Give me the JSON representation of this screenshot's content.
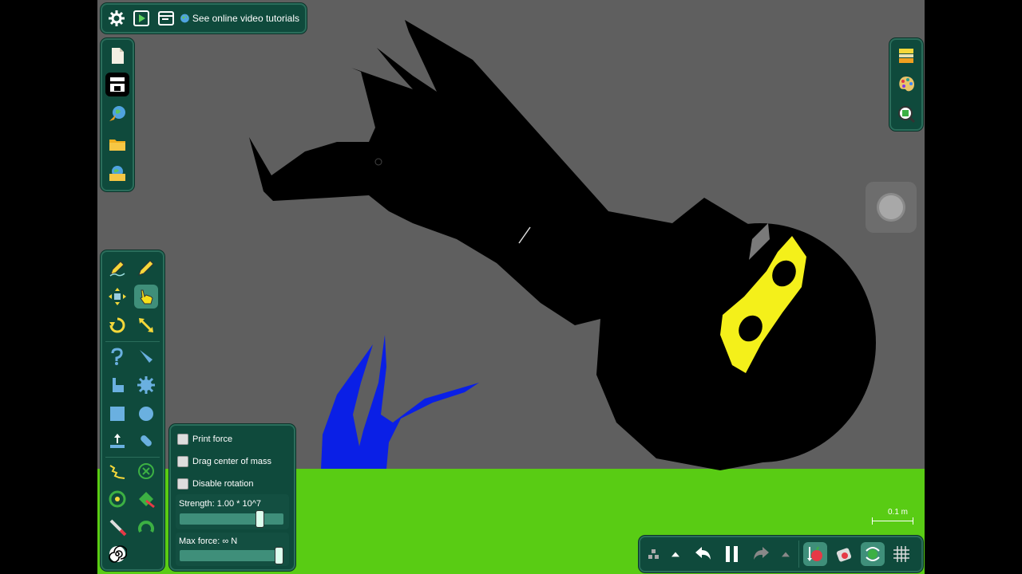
{
  "top_bar": {
    "tutorials_label": "See online video tutorials"
  },
  "options": {
    "print_force": "Print force",
    "drag_center": "Drag center of mass",
    "disable_rotation": "Disable rotation",
    "strength_label": "Strength:  1.00 * 10^7",
    "strength_value": 0.8,
    "max_force_label": "Max force:  ∞  N",
    "max_force_value": 1.0
  },
  "scale_label": "0.1 m",
  "colors": {
    "panel": "#0f4a3c",
    "active": "#3f8f7a",
    "ground": "#59cc14",
    "background": "#5f5f5f",
    "ninja_mask": "#f4f01a",
    "blue_shape": "#0a1fe6"
  }
}
